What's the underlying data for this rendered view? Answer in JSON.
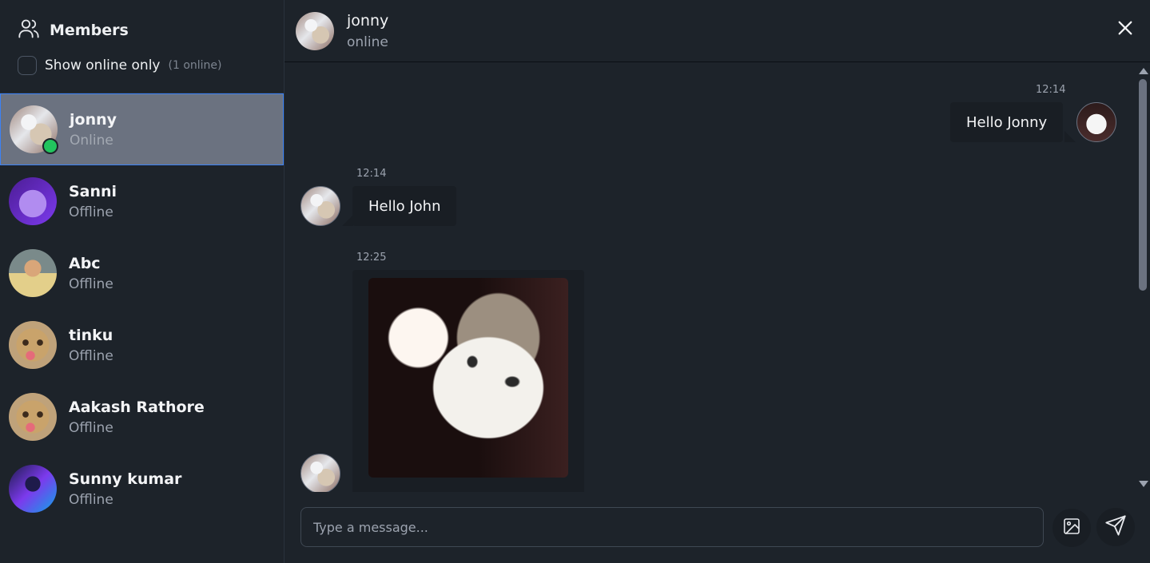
{
  "sidebar": {
    "title": "Members",
    "filter_label": "Show online only",
    "online_count": "(1 online)",
    "members": [
      {
        "name": "jonny",
        "status": "Online"
      },
      {
        "name": "Sanni",
        "status": "Offline"
      },
      {
        "name": "Abc",
        "status": "Offline"
      },
      {
        "name": "tinku",
        "status": "Offline"
      },
      {
        "name": "Aakash Rathore",
        "status": "Offline"
      },
      {
        "name": "Sunny kumar",
        "status": "Offline"
      }
    ]
  },
  "chat": {
    "user_name": "jonny",
    "user_status": "online",
    "messages": [
      {
        "time": "12:14",
        "text": "Hello Jonny",
        "direction": "sent"
      },
      {
        "time": "12:14",
        "text": "Hello John",
        "direction": "received"
      },
      {
        "time": "12:25",
        "type": "image",
        "direction": "received"
      }
    ],
    "composer_placeholder": "Type a message..."
  },
  "colors": {
    "background": "#1d232a",
    "bubble": "#191e24",
    "active_member": "#6b7280",
    "online": "#22c55e"
  },
  "icons": [
    "users-icon",
    "close-icon",
    "image-icon",
    "send-icon"
  ]
}
